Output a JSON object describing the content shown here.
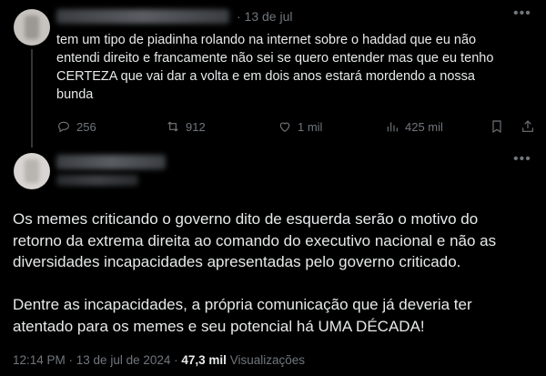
{
  "reply_tweet": {
    "date": "· 13 de jul",
    "text_lines": [
      "tem um tipo de piadinha rolando na internet sobre o haddad que eu não",
      "entendi direito e francamente não sei se quero entender mas que eu tenho",
      "CERTEZA que vai dar a volta e em dois anos estará mordendo a nossa",
      "bunda"
    ],
    "actions": {
      "replies": "256",
      "reposts": "912",
      "likes": "1 mil",
      "views": "425 mil"
    }
  },
  "main_tweet": {
    "paragraph1_lines": [
      "Os memes criticando o governo dito de esquerda serão o motivo do",
      "retorno da extrema direita ao comando do executivo nacional e não as",
      "diversidades incapacidades apresentadas pelo governo criticado."
    ],
    "paragraph2_lines": [
      "Dentre as incapacidades, a própria comunicação que já deveria ter",
      "atentado para os memes e seu potencial há UMA DÉCADA!"
    ],
    "timestamp": "12:14 PM · 13 de jul de 2024 ·",
    "views_count": "47,3 mil",
    "views_label": "Visualizações"
  },
  "icons": [
    "more-icon",
    "reply-icon",
    "repost-icon",
    "like-icon",
    "views-icon",
    "bookmark-icon",
    "share-icon"
  ],
  "colors": {
    "background": "#000000",
    "text": "#e7e9ea",
    "muted": "#71767b",
    "divider": "#2f3336"
  }
}
